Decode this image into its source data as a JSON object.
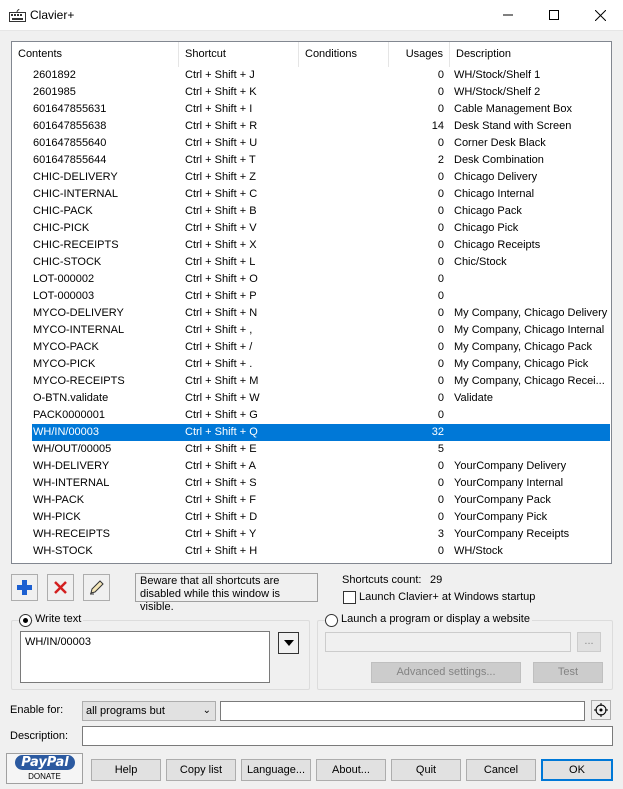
{
  "window": {
    "title": "Clavier+"
  },
  "columns": [
    "Contents",
    "Shortcut",
    "Conditions",
    "Usages",
    "Description"
  ],
  "rows": [
    {
      "contents": "2601892",
      "shortcut": "Ctrl + Shift + J",
      "usages": "0",
      "description": "WH/Stock/Shelf 1"
    },
    {
      "contents": "2601985",
      "shortcut": "Ctrl + Shift + K",
      "usages": "0",
      "description": "WH/Stock/Shelf 2"
    },
    {
      "contents": "601647855631",
      "shortcut": "Ctrl + Shift + I",
      "usages": "0",
      "description": "Cable Management Box"
    },
    {
      "contents": "601647855638",
      "shortcut": "Ctrl + Shift + R",
      "usages": "14",
      "description": "Desk Stand with Screen"
    },
    {
      "contents": "601647855640",
      "shortcut": "Ctrl + Shift + U",
      "usages": "0",
      "description": "Corner Desk Black"
    },
    {
      "contents": "601647855644",
      "shortcut": "Ctrl + Shift + T",
      "usages": "2",
      "description": "Desk Combination"
    },
    {
      "contents": "CHIC-DELIVERY",
      "shortcut": "Ctrl + Shift + Z",
      "usages": "0",
      "description": "Chicago Delivery"
    },
    {
      "contents": "CHIC-INTERNAL",
      "shortcut": "Ctrl + Shift + C",
      "usages": "0",
      "description": "Chicago Internal"
    },
    {
      "contents": "CHIC-PACK",
      "shortcut": "Ctrl + Shift + B",
      "usages": "0",
      "description": "Chicago Pack"
    },
    {
      "contents": "CHIC-PICK",
      "shortcut": "Ctrl + Shift + V",
      "usages": "0",
      "description": "Chicago Pick"
    },
    {
      "contents": "CHIC-RECEIPTS",
      "shortcut": "Ctrl + Shift + X",
      "usages": "0",
      "description": "Chicago Receipts"
    },
    {
      "contents": "CHIC-STOCK",
      "shortcut": "Ctrl + Shift + L",
      "usages": "0",
      "description": "Chic/Stock"
    },
    {
      "contents": "LOT-000002",
      "shortcut": "Ctrl + Shift + O",
      "usages": "0",
      "description": ""
    },
    {
      "contents": "LOT-000003",
      "shortcut": "Ctrl + Shift + P",
      "usages": "0",
      "description": ""
    },
    {
      "contents": "MYCO-DELIVERY",
      "shortcut": "Ctrl + Shift + N",
      "usages": "0",
      "description": "My Company, Chicago Delivery"
    },
    {
      "contents": "MYCO-INTERNAL",
      "shortcut": "Ctrl + Shift + ,",
      "usages": "0",
      "description": "My Company, Chicago Internal"
    },
    {
      "contents": "MYCO-PACK",
      "shortcut": "Ctrl + Shift + /",
      "usages": "0",
      "description": "My Company, Chicago Pack"
    },
    {
      "contents": "MYCO-PICK",
      "shortcut": "Ctrl + Shift + .",
      "usages": "0",
      "description": "My Company, Chicago Pick"
    },
    {
      "contents": "MYCO-RECEIPTS",
      "shortcut": "Ctrl + Shift + M",
      "usages": "0",
      "description": "My Company, Chicago Recei..."
    },
    {
      "contents": "O-BTN.validate",
      "shortcut": "Ctrl + Shift + W",
      "usages": "0",
      "description": "Validate"
    },
    {
      "contents": "PACK0000001",
      "shortcut": "Ctrl + Shift + G",
      "usages": "0",
      "description": ""
    },
    {
      "contents": "WH/IN/00003",
      "shortcut": "Ctrl + Shift + Q",
      "usages": "32",
      "description": "",
      "selected": true
    },
    {
      "contents": "WH/OUT/00005",
      "shortcut": "Ctrl + Shift + E",
      "usages": "5",
      "description": ""
    },
    {
      "contents": "WH-DELIVERY",
      "shortcut": "Ctrl + Shift + A",
      "usages": "0",
      "description": "YourCompany Delivery"
    },
    {
      "contents": "WH-INTERNAL",
      "shortcut": "Ctrl + Shift + S",
      "usages": "0",
      "description": "YourCompany Internal"
    },
    {
      "contents": "WH-PACK",
      "shortcut": "Ctrl + Shift + F",
      "usages": "0",
      "description": "YourCompany Pack"
    },
    {
      "contents": "WH-PICK",
      "shortcut": "Ctrl + Shift + D",
      "usages": "0",
      "description": "YourCompany Pick"
    },
    {
      "contents": "WH-RECEIPTS",
      "shortcut": "Ctrl + Shift + Y",
      "usages": "3",
      "description": "YourCompany Receipts"
    },
    {
      "contents": "WH-STOCK",
      "shortcut": "Ctrl + Shift + H",
      "usages": "0",
      "description": "WH/Stock"
    }
  ],
  "toolbar": {
    "warning": "Beware that all shortcuts are disabled while this window is visible.",
    "count_label": "Shortcuts count:",
    "count_value": "29",
    "startup_label": "Launch Clavier+ at Windows startup"
  },
  "write_text": {
    "label": "Write text",
    "value": "WH/IN/00003"
  },
  "launch": {
    "label": "Launch a program or display a website",
    "browse_label": "...",
    "advanced_label": "Advanced settings...",
    "test_label": "Test"
  },
  "form": {
    "enable_label": "Enable for:",
    "enable_value": "all programs but",
    "description_label": "Description:"
  },
  "paypal": {
    "logo": "PayPal",
    "donate": "DONATE"
  },
  "buttons": {
    "help": "Help",
    "copy_list": "Copy list",
    "language": "Language...",
    "about": "About...",
    "quit": "Quit",
    "cancel": "Cancel",
    "ok": "OK"
  }
}
